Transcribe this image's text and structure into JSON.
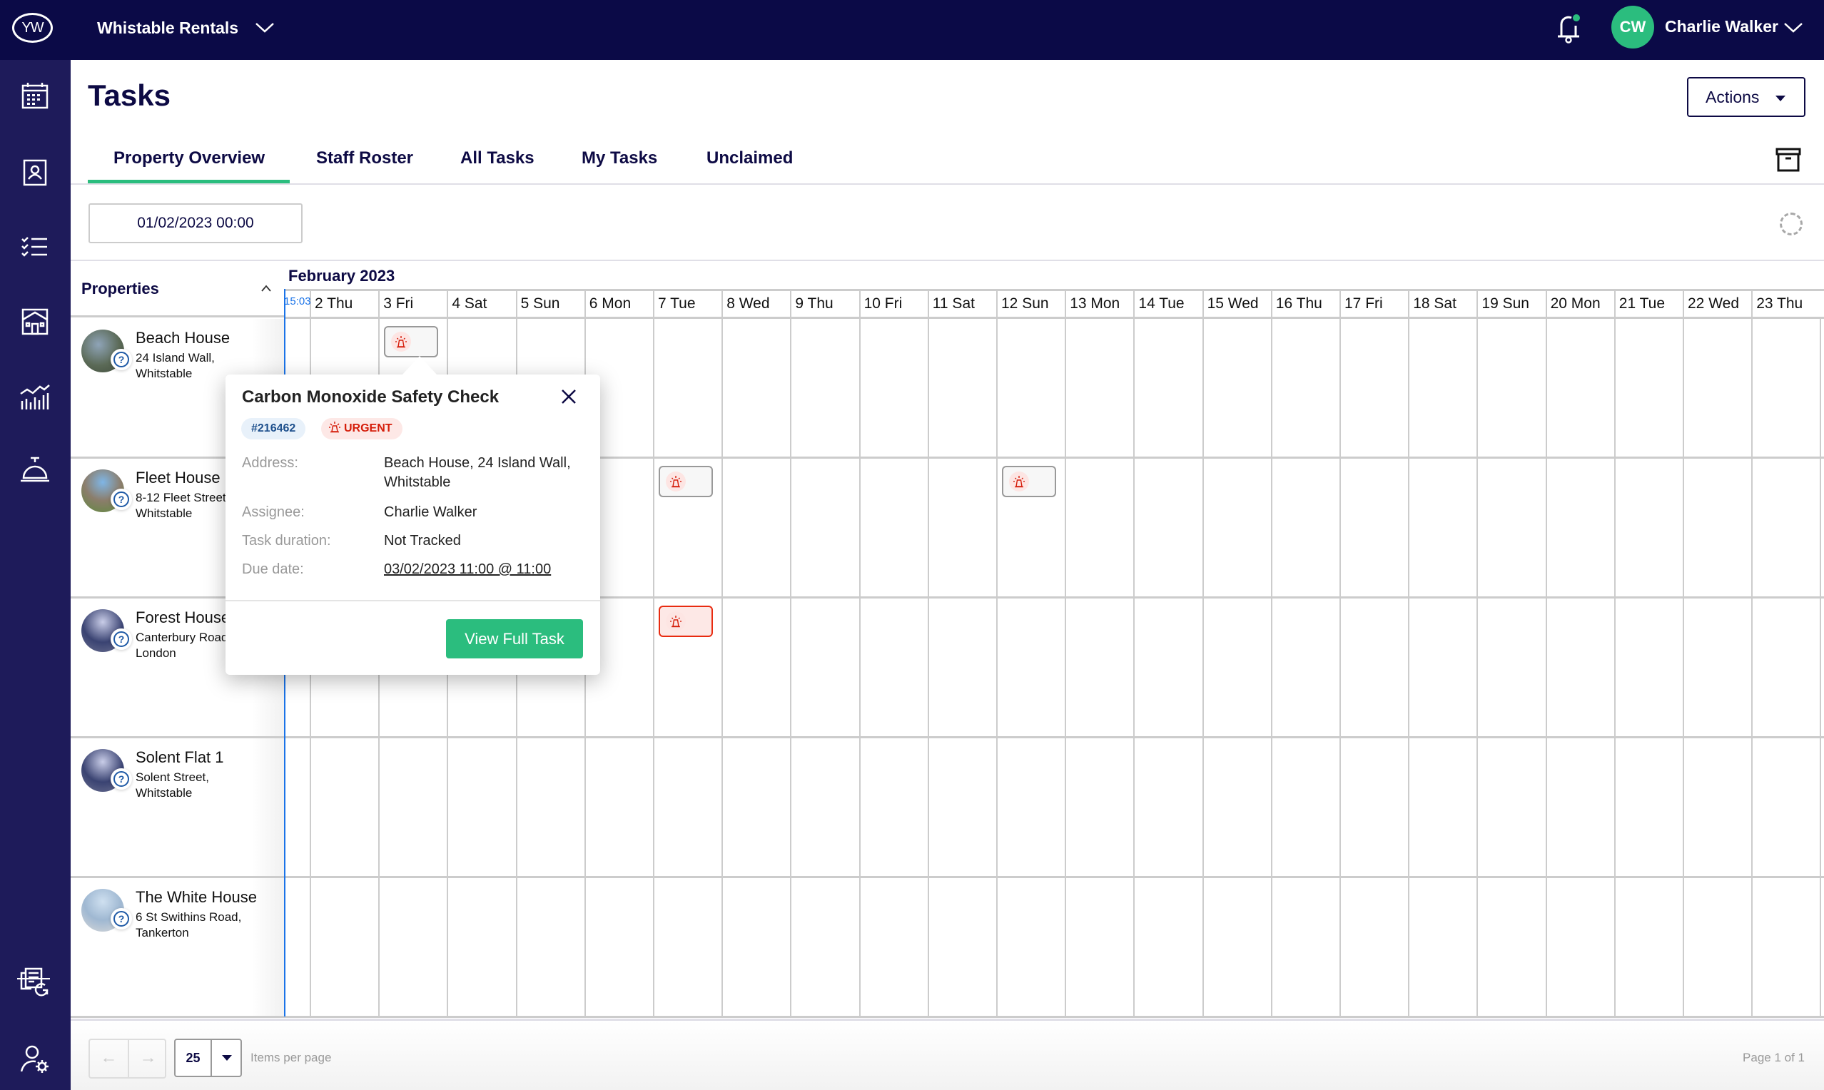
{
  "topbar": {
    "logo_text": "YW",
    "org_name": "Whistable Rentals",
    "user_initials": "CW",
    "user_name": "Charlie Walker",
    "accent_color": "#2bbd7e",
    "notification_dot": true
  },
  "sidebar": {
    "items": [
      {
        "icon": "calendar-icon"
      },
      {
        "icon": "contacts-book-icon"
      },
      {
        "icon": "checklist-icon"
      },
      {
        "icon": "property-icon"
      },
      {
        "icon": "analytics-icon"
      },
      {
        "icon": "service-bell-icon"
      },
      {
        "icon": "reports-refresh-icon"
      },
      {
        "icon": "user-settings-icon"
      }
    ]
  },
  "page": {
    "title": "Tasks",
    "actions_label": "Actions"
  },
  "tabs": [
    {
      "label": "Property Overview",
      "active": true
    },
    {
      "label": "Staff Roster",
      "active": false
    },
    {
      "label": "All Tasks",
      "active": false
    },
    {
      "label": "My Tasks",
      "active": false
    },
    {
      "label": "Unclaimed",
      "active": false
    }
  ],
  "filters": {
    "start_date": "01/02/2023 00:00"
  },
  "calendar": {
    "properties_header": "Properties",
    "month_label": "February 2023",
    "now_label": "15:03",
    "days": [
      "2 Thu",
      "3 Fri",
      "4 Sat",
      "5 Sun",
      "6 Mon",
      "7 Tue",
      "8 Wed",
      "9 Thu",
      "10 Fri",
      "11 Sat",
      "12 Sun",
      "13 Mon",
      "14 Tue",
      "15 Wed",
      "16 Thu",
      "17 Fri",
      "18 Sat",
      "19 Sun",
      "20 Mon",
      "21 Tue",
      "22 Wed",
      "23 Thu"
    ],
    "properties": [
      {
        "name": "Beach House",
        "address": "24 Island Wall,\nWhitstable",
        "tasks": [
          {
            "day": "3 Fri",
            "type": "urgent",
            "selected": false
          }
        ]
      },
      {
        "name": "Fleet House",
        "address": "8-12 Fleet Street,\nWhitstable",
        "tasks": [
          {
            "day": "7 Tue",
            "type": "urgent",
            "selected": false
          },
          {
            "day": "12 Sun",
            "type": "urgent",
            "selected": false
          }
        ]
      },
      {
        "name": "Forest House",
        "address": "Canterbury Road,\nLondon",
        "tasks": [
          {
            "day": "7 Tue",
            "type": "urgent",
            "selected": true
          }
        ]
      },
      {
        "name": "Solent Flat 1",
        "address": "Solent Street,\nWhitstable",
        "tasks": []
      },
      {
        "name": "The White House",
        "address": "6 St Swithins Road,\nTankerton",
        "tasks": []
      }
    ]
  },
  "popover": {
    "title": "Carbon Monoxide Safety Check",
    "task_id": "#216462",
    "priority": "URGENT",
    "fields": [
      {
        "label": "Address:",
        "value": "Beach House, 24 Island Wall, Whitstable"
      },
      {
        "label": "Assignee:",
        "value": "Charlie Walker"
      },
      {
        "label": "Task duration:",
        "value": "Not Tracked"
      },
      {
        "label": "Due date:",
        "value": "03/02/2023 11:00 @ 11:00"
      }
    ],
    "button_label": "View Full Task"
  },
  "footer": {
    "prev_label": "←",
    "next_label": "→",
    "items_per_page": "25",
    "items_per_page_label": "Items per page",
    "page_info": "Page 1 of 1"
  }
}
